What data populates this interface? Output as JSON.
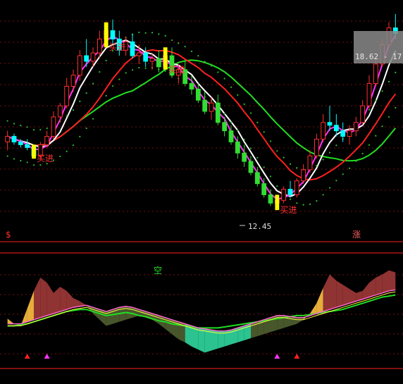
{
  "chart_data": [
    {
      "type": "candlestick",
      "panel": "price",
      "candles": [
        [
          14.9,
          15.3,
          14.6,
          15.1
        ],
        [
          15.1,
          15.2,
          14.8,
          14.9
        ],
        [
          14.9,
          15.0,
          14.7,
          14.8
        ],
        [
          14.8,
          15.0,
          14.6,
          14.7
        ],
        [
          14.7,
          14.8,
          14.3,
          14.4
        ],
        [
          14.4,
          14.9,
          14.3,
          14.8
        ],
        [
          14.8,
          15.3,
          14.7,
          15.1
        ],
        [
          15.1,
          16.0,
          15.0,
          15.8
        ],
        [
          15.8,
          16.3,
          15.6,
          16.2
        ],
        [
          16.2,
          17.2,
          16.1,
          16.9
        ],
        [
          16.9,
          17.5,
          16.7,
          17.3
        ],
        [
          17.3,
          18.2,
          17.1,
          18.0
        ],
        [
          18.0,
          18.6,
          17.6,
          17.8
        ],
        [
          17.8,
          18.3,
          17.6,
          18.1
        ],
        [
          18.1,
          18.9,
          17.9,
          18.6
        ],
        [
          18.6,
          19.2,
          18.3,
          18.9
        ],
        [
          18.9,
          19.3,
          18.4,
          18.6
        ],
        [
          18.6,
          18.9,
          18.0,
          18.2
        ],
        [
          18.2,
          18.7,
          18.0,
          18.5
        ],
        [
          18.5,
          18.8,
          17.9,
          18.0
        ],
        [
          18.0,
          18.4,
          17.7,
          18.1
        ],
        [
          18.1,
          18.3,
          17.6,
          17.8
        ],
        [
          17.8,
          18.1,
          17.5,
          17.9
        ],
        [
          17.9,
          18.2,
          17.4,
          17.6
        ],
        [
          17.6,
          18.3,
          17.5,
          18.0
        ],
        [
          18.0,
          18.3,
          17.2,
          17.3
        ],
        [
          17.3,
          17.7,
          17.0,
          17.5
        ],
        [
          17.5,
          17.8,
          16.9,
          17.0
        ],
        [
          17.0,
          17.3,
          16.6,
          16.8
        ],
        [
          16.8,
          17.0,
          16.3,
          16.4
        ],
        [
          16.4,
          16.7,
          15.9,
          16.0
        ],
        [
          16.0,
          16.5,
          15.7,
          16.3
        ],
        [
          16.3,
          16.6,
          15.5,
          15.6
        ],
        [
          15.6,
          15.8,
          15.1,
          15.3
        ],
        [
          15.3,
          15.5,
          14.8,
          14.9
        ],
        [
          14.9,
          15.1,
          14.3,
          14.5
        ],
        [
          14.5,
          14.8,
          14.0,
          14.2
        ],
        [
          14.2,
          14.4,
          13.7,
          13.8
        ],
        [
          13.8,
          14.0,
          13.3,
          13.4
        ],
        [
          13.4,
          13.6,
          12.9,
          13.0
        ],
        [
          13.0,
          13.2,
          12.6,
          12.7
        ],
        [
          12.7,
          13.0,
          12.45,
          12.8
        ],
        [
          12.8,
          13.3,
          12.7,
          13.2
        ],
        [
          13.2,
          13.5,
          12.9,
          13.0
        ],
        [
          13.0,
          13.6,
          12.9,
          13.5
        ],
        [
          13.5,
          14.1,
          13.4,
          13.9
        ],
        [
          13.9,
          14.6,
          13.8,
          14.4
        ],
        [
          14.4,
          15.2,
          14.3,
          15.0
        ],
        [
          15.0,
          15.9,
          14.9,
          15.6
        ],
        [
          15.6,
          16.2,
          15.3,
          15.5
        ],
        [
          15.5,
          15.9,
          15.1,
          15.3
        ],
        [
          15.3,
          15.6,
          14.9,
          15.1
        ],
        [
          15.1,
          15.5,
          14.8,
          15.3
        ],
        [
          15.3,
          15.8,
          15.1,
          15.6
        ],
        [
          15.6,
          16.4,
          15.5,
          16.2
        ],
        [
          16.2,
          17.3,
          16.1,
          17.0
        ],
        [
          17.0,
          18.0,
          16.9,
          17.7
        ],
        [
          17.7,
          18.6,
          17.6,
          18.4
        ],
        [
          18.4,
          19.2,
          18.3,
          19.0
        ],
        [
          19.0,
          19.5,
          18.6,
          18.8
        ]
      ],
      "buy_signals": [
        {
          "index": 4,
          "text": "买进"
        },
        {
          "index": 15,
          "text": "买进"
        },
        {
          "index": 24,
          "text": "买进"
        },
        {
          "index": 41,
          "text": "买进"
        }
      ],
      "low_marker": "12.45",
      "price_label": "18.62 - 17.18",
      "left_mark": "$",
      "right_mark": "涨",
      "colors": {
        "up": "#ff3030",
        "down": "#00ffff",
        "down_green": "#33dd33",
        "ma_white": "#ffffff",
        "ma_magenta": "#ff33ff",
        "ma_red": "#ff2020",
        "ma_green": "#22dd22",
        "band_dots": "#2fbf2f",
        "signal_bar": "#ffff00"
      }
    },
    {
      "type": "area",
      "panel": "indicator",
      "label": "空",
      "series": [
        {
          "name": "A",
          "values": [
            45,
            40,
            38,
            55,
            72,
            85,
            80,
            70,
            76,
            72,
            65,
            62,
            58,
            50,
            44,
            38,
            40,
            42,
            44,
            46,
            48,
            46,
            44,
            40,
            35,
            30,
            25,
            22,
            18,
            15,
            12,
            14,
            16,
            18,
            20,
            22,
            24,
            26,
            28,
            30,
            32,
            34,
            36,
            38,
            40,
            44,
            50,
            60,
            75,
            88,
            82,
            78,
            74,
            70,
            72,
            80,
            85,
            88,
            92,
            90
          ]
        },
        {
          "name": "B",
          "values": [
            40,
            40,
            40,
            42,
            44,
            46,
            48,
            50,
            52,
            54,
            56,
            57,
            58,
            56,
            54,
            52,
            54,
            56,
            57,
            56,
            54,
            52,
            50,
            48,
            46,
            44,
            42,
            40,
            38,
            36,
            35,
            34,
            33,
            33,
            34,
            36,
            38,
            40,
            42,
            44,
            46,
            48,
            48,
            47,
            46,
            46,
            48,
            50,
            52,
            54,
            56,
            58,
            60,
            62,
            64,
            66,
            68,
            70,
            72,
            73
          ]
        },
        {
          "name": "C",
          "values": [
            38,
            38,
            39,
            40,
            42,
            44,
            46,
            48,
            50,
            52,
            53,
            54,
            54,
            52,
            50,
            48,
            49,
            50,
            51,
            50,
            48,
            47,
            45,
            43,
            42,
            40,
            39,
            38,
            37,
            36,
            36,
            36,
            36,
            37,
            38,
            39,
            40,
            41,
            42,
            43,
            44,
            45,
            46,
            47,
            48,
            48,
            49,
            50,
            51,
            52,
            53,
            54,
            56,
            58,
            60,
            62,
            64,
            66,
            67,
            68
          ]
        }
      ],
      "triangles": [
        {
          "index": 3,
          "color": "#ff2020"
        },
        {
          "index": 6,
          "color": "#ff33ff"
        },
        {
          "index": 41,
          "color": "#ff33ff"
        },
        {
          "index": 44,
          "color": "#ff2020"
        }
      ],
      "colors": {
        "warm": "#ffc040",
        "cool": "#30d8a0",
        "brown": "#a03838",
        "olive": "#506030",
        "line_green": "#22dd22",
        "line_pink": "#ff66cc",
        "line_yellow": "#ffff40",
        "label": "#22dd22"
      }
    }
  ]
}
